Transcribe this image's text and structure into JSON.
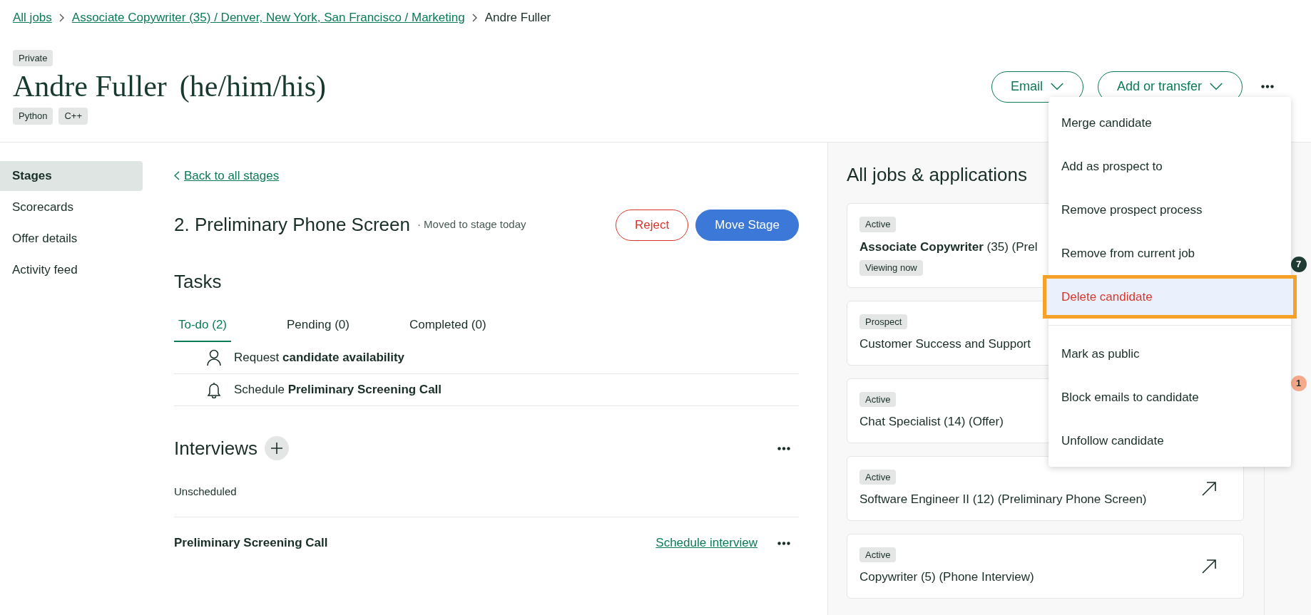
{
  "breadcrumb": [
    {
      "label": "All jobs",
      "link": true
    },
    {
      "label": "Associate Copywriter (35) / Denver, New York, San Francisco / Marketing",
      "link": true
    },
    {
      "label": "Andre Fuller",
      "link": false
    }
  ],
  "candidate": {
    "visibility": "Private",
    "name": "Andre Fuller",
    "pronouns": "(he/him/his)",
    "tags": [
      "Python",
      "C++"
    ]
  },
  "header_actions": {
    "buttons": [
      {
        "label": "Email"
      },
      {
        "label": "Add or transfer"
      }
    ]
  },
  "sidebar": {
    "items": [
      {
        "label": "Stages",
        "selected": true
      },
      {
        "label": "Scorecards",
        "selected": false
      },
      {
        "label": "Offer details",
        "selected": false
      },
      {
        "label": "Activity feed",
        "selected": false
      }
    ]
  },
  "stage": {
    "back_link": "Back to all stages",
    "title": "2. Preliminary Phone Screen",
    "subtitle": "· Moved to stage today",
    "buttons": [
      {
        "label": "Reject",
        "kind": "danger"
      },
      {
        "label": "Move Stage",
        "kind": "primary"
      }
    ]
  },
  "tasks": {
    "title": "Tasks",
    "tabs": [
      {
        "label": "To-do (2)",
        "selected": true
      },
      {
        "label": "Pending (0)",
        "selected": false
      },
      {
        "label": "Completed (0)",
        "selected": false
      }
    ],
    "items": [
      {
        "kind": "person",
        "text": "Request **candidate availability**"
      },
      {
        "kind": "bell",
        "text": "Schedule **Preliminary Screening Call**"
      }
    ]
  },
  "interviews": {
    "title": "Interviews",
    "group": "Unscheduled",
    "items": [
      {
        "name": "Preliminary Screening Call",
        "action": "Schedule interview"
      }
    ]
  },
  "applications": {
    "title": "All jobs & applications",
    "cards": [
      {
        "status": "Active",
        "title_bold": "Associate Copywriter",
        "title": " (35) (Prel",
        "badge": "Viewing now"
      },
      {
        "status": "Prospect",
        "title": "Customer Success and Support"
      },
      {
        "status": "Active",
        "title": "Chat Specialist (14) (Offer)"
      },
      {
        "status": "Active",
        "title": "Software Engineer II (12) (Preliminary Phone Screen)"
      },
      {
        "status": "Active",
        "title": "Copywriter (5) (Phone Interview)"
      }
    ]
  },
  "rail": {
    "badges": [
      {
        "count": "7",
        "color": "#1f3b33"
      },
      {
        "count": "1",
        "color": "#f6a98a"
      }
    ]
  },
  "menu": {
    "items": [
      {
        "label": "Merge candidate",
        "danger": false,
        "highlighted": false
      },
      {
        "label": "Add as prospect to",
        "danger": false,
        "highlighted": false
      },
      {
        "label": "Remove prospect process",
        "danger": false,
        "highlighted": false
      },
      {
        "label": "Remove from current job",
        "danger": false,
        "highlighted": false
      },
      {
        "label": "Delete candidate",
        "danger": true,
        "highlighted": true
      },
      {
        "label": "Mark as public",
        "danger": false,
        "highlighted": false,
        "divider": true
      },
      {
        "label": "Block emails to candidate",
        "danger": false,
        "highlighted": false
      },
      {
        "label": "Unfollow candidate",
        "danger": false,
        "highlighted": false
      }
    ]
  }
}
